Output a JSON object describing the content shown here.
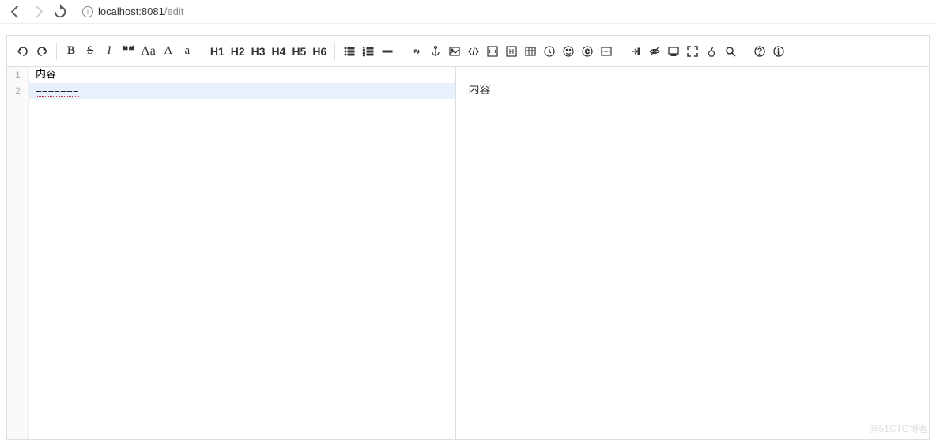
{
  "browser": {
    "url_host": "localhost:8081",
    "url_path": "/edit"
  },
  "toolbar": {
    "bold": "B",
    "strike": "S",
    "italic": "I",
    "quote": "❝❝",
    "caseAa": "Aa",
    "caseA": "A",
    "caseLower": "a",
    "h1": "H1",
    "h2": "H2",
    "h3": "H3",
    "h4": "H4",
    "h5": "H5",
    "h6": "H6"
  },
  "editor": {
    "lines": [
      "1",
      "2"
    ],
    "line1": "内容",
    "line2": "======="
  },
  "preview": {
    "content": "内容"
  },
  "watermark": "@51CTO博客"
}
